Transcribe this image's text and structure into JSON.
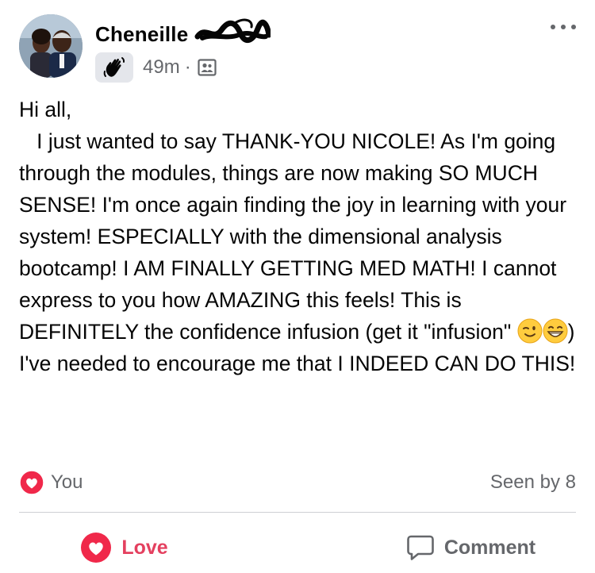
{
  "post": {
    "author_name": "Cheneille",
    "timestamp": "49m",
    "separator": "·",
    "audience_icon": "group-members-icon",
    "badge_icon": "waving-hand-icon",
    "more_icon": "more-options-icon",
    "body_part1": "Hi all,\n   I just wanted to say THANK-YOU NICOLE! As I'm going through the modules, things are now making SO MUCH SENSE! I'm once again finding the joy in learning with your system! ESPECIALLY with the dimensional analysis bootcamp! I AM FINALLY GETTING MED MATH! I cannot express to you how AMAZING this feels! This is DEFINITELY the confidence infusion (get it \"infusion\" ",
    "emoji_1": "winking-face-emoji",
    "emoji_2": "grinning-face-emoji",
    "body_part2": ") I've needed to encourage me that I INDEED CAN DO THIS!"
  },
  "reactions": {
    "reactor": "You",
    "reaction_icon": "heart-reaction-icon",
    "seen_by": "Seen by 8"
  },
  "actions": {
    "love_label": "Love",
    "comment_label": "Comment"
  },
  "colors": {
    "love_red": "#e4405f",
    "meta_gray": "#65676b",
    "divider": "#ced0d4",
    "badge_bg": "#e4e6eb"
  }
}
